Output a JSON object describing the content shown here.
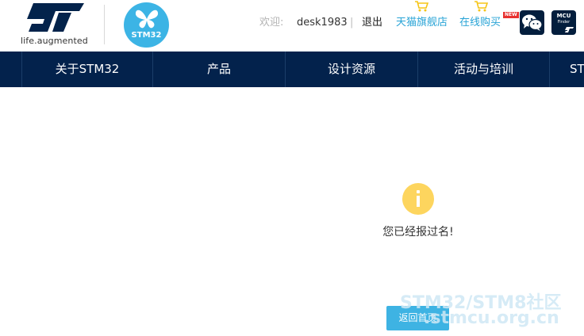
{
  "brand": {
    "tagline": "life.augmented",
    "badge_text": "STM32"
  },
  "user_bar": {
    "welcome_label": "欢迎:",
    "username": "desk1983",
    "separator": "|",
    "logout": "退出",
    "tmall_store": "天猫旗舰店",
    "online_shop": "在线购买",
    "new_badge": "NEW",
    "mcu_finder_line1": "MCU",
    "mcu_finder_line2": "Finder"
  },
  "nav": {
    "items": [
      "关于STM32",
      "产品",
      "设计资源",
      "活动与培训",
      "ST"
    ]
  },
  "content": {
    "message": "您已经报过名!",
    "back_button": "返回首页"
  },
  "watermark": {
    "line1": "STM32/STM8社区",
    "line2": ".stmcu.org.cn"
  },
  "colors": {
    "nav_bg": "#03224c",
    "accent": "#3eb3e3",
    "info": "#fdd55e"
  }
}
